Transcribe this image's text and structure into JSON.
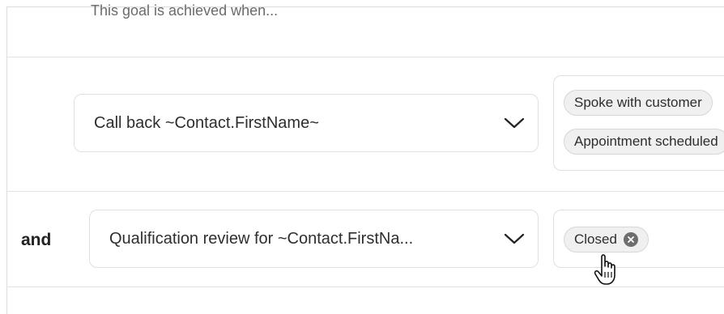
{
  "goal_header": {
    "text": "This goal is achieved when..."
  },
  "rows": [
    {
      "connector": "",
      "task": {
        "selected": "Call back ~Contact.FirstName~",
        "icon": "chevron-down-icon"
      },
      "outcomes": [
        {
          "label": "Spoke with customer"
        },
        {
          "label": "Appointment scheduled"
        }
      ]
    },
    {
      "connector": "and",
      "task": {
        "selected": "Qualification review for ~Contact.FirstNa...",
        "icon": "chevron-down-icon"
      },
      "outcomes": [
        {
          "label": "Closed",
          "removable": true,
          "remove_icon": "close-circle-icon"
        }
      ]
    }
  ],
  "cursor": {
    "icon": "hand-pointer-icon"
  },
  "colors": {
    "chip_bg": "#f0f0f0",
    "chip_border": "#d6d6d6",
    "border": "#e0e0e0",
    "text": "#2e2e2e",
    "muted_text": "#6b6b6b"
  }
}
